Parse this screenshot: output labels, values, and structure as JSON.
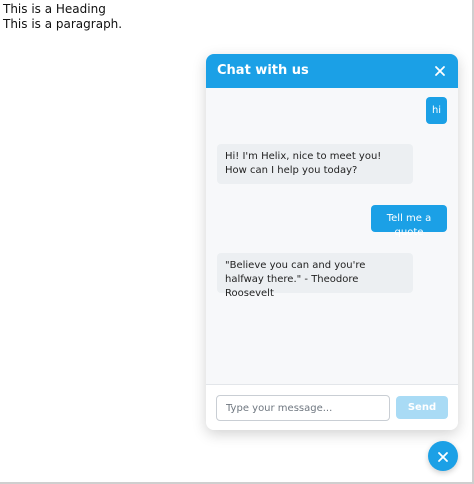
{
  "page": {
    "heading": "This is a Heading",
    "paragraph": "This is a paragraph."
  },
  "chat": {
    "title": "Chat with us",
    "messages": [
      {
        "sender": "user",
        "text": "hi"
      },
      {
        "sender": "bot",
        "text": "Hi! I'm Helix, nice to meet you! How can I help you today?"
      },
      {
        "sender": "user",
        "text": "Tell me a quote"
      },
      {
        "sender": "bot",
        "text": "\"Believe you can and you're halfway there.\" - Theodore Roosevelt"
      }
    ],
    "input": {
      "placeholder": "Type your message...",
      "value": ""
    },
    "send_label": "Send"
  },
  "icons": {
    "header_close": "close-icon",
    "launcher": "close-icon"
  },
  "colors": {
    "accent": "#1ba0e6",
    "send_disabled": "#a9dbf5",
    "bot_bubble": "#eceff2",
    "panel_bg": "#f7f8fa"
  }
}
